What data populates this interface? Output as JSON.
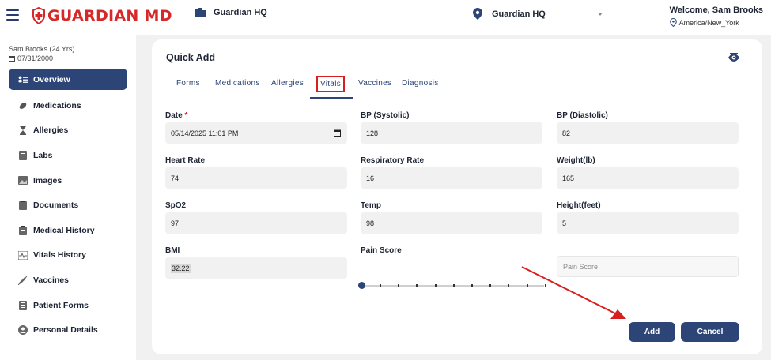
{
  "header": {
    "brand": "GUARDIAN MD",
    "clinic_left": "Guardian HQ",
    "clinic_selected": "Guardian HQ",
    "welcome": "Welcome, Sam Brooks",
    "timezone": "America/New_York"
  },
  "patient": {
    "name": "Sam Brooks (24 Yrs)",
    "dob": "07/31/2000"
  },
  "sidebar": {
    "items": [
      {
        "label": "Overview",
        "icon": "overview-icon"
      },
      {
        "label": "Medications",
        "icon": "pill-icon"
      },
      {
        "label": "Allergies",
        "icon": "hourglass-icon"
      },
      {
        "label": "Labs",
        "icon": "document-icon"
      },
      {
        "label": "Images",
        "icon": "image-icon"
      },
      {
        "label": "Documents",
        "icon": "clipboard-icon"
      },
      {
        "label": "Medical History",
        "icon": "clipboard-icon"
      },
      {
        "label": "Vitals History",
        "icon": "vitals-icon"
      },
      {
        "label": "Vaccines",
        "icon": "syringe-icon"
      },
      {
        "label": "Patient Forms",
        "icon": "form-icon"
      },
      {
        "label": "Personal Details",
        "icon": "person-icon"
      }
    ]
  },
  "card": {
    "title": "Quick Add",
    "tabs": [
      "Forms",
      "Medications",
      "Allergies",
      "Vitals",
      "Vaccines",
      "Diagnosis"
    ],
    "active_tab": "Vitals"
  },
  "form": {
    "date": {
      "label": "Date",
      "required": "*",
      "value": "05/14/2025 11:01 PM"
    },
    "bp_systolic": {
      "label": "BP (Systolic)",
      "value": "128"
    },
    "bp_diastolic": {
      "label": "BP (Diastolic)",
      "value": "82"
    },
    "heart_rate": {
      "label": "Heart Rate",
      "value": "74"
    },
    "respiratory_rate": {
      "label": "Respiratory Rate",
      "value": "16"
    },
    "weight": {
      "label": "Weight(lb)",
      "value": "165"
    },
    "spo2": {
      "label": "SpO2",
      "value": "97"
    },
    "temp": {
      "label": "Temp",
      "value": "98"
    },
    "height": {
      "label": "Height(feet)",
      "value": "5"
    },
    "bmi": {
      "label": "BMI",
      "value": "32.22"
    },
    "pain_score": {
      "label": "Pain Score",
      "placeholder": "Pain Score",
      "slider_value": 0
    }
  },
  "actions": {
    "add": "Add",
    "cancel": "Cancel"
  },
  "colors": {
    "brand_red": "#d62828",
    "primary_navy": "#2c4576",
    "annotation_red": "#d61f1f"
  }
}
